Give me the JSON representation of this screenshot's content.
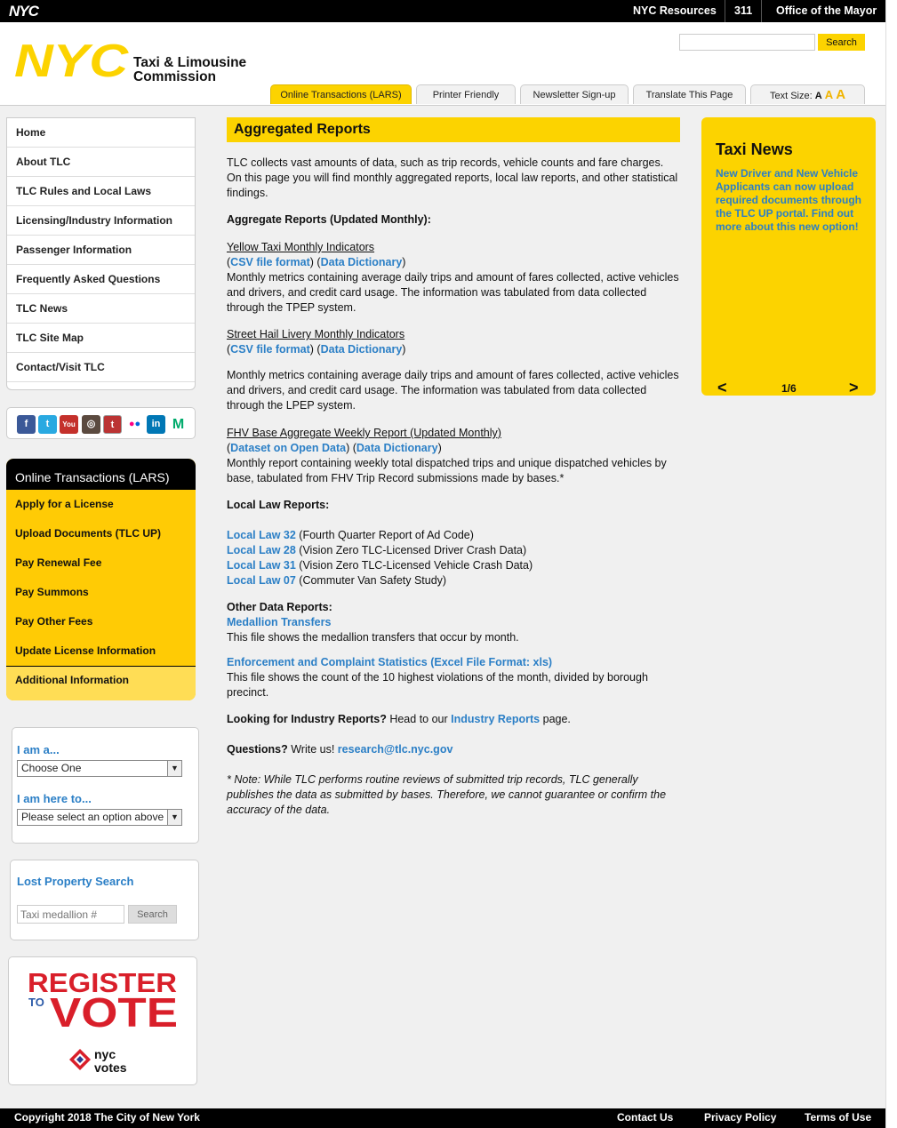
{
  "topbar": {
    "brand": "NYC",
    "links": [
      "NYC Resources",
      "311",
      "Office of the Mayor"
    ]
  },
  "header": {
    "logo_text": "NYC",
    "title_line1": "Taxi & Limousine",
    "title_line2": "Commission",
    "search_button": "Search",
    "search_value": "",
    "tabs": [
      "Online Transactions (LARS)",
      "Printer Friendly",
      "Newsletter Sign-up",
      "Translate This Page"
    ],
    "text_size_label": "Text Size:",
    "text_size_options": [
      "A",
      "A",
      "A"
    ]
  },
  "leftnav": {
    "items": [
      "Home",
      "About TLC",
      "TLC Rules and Local Laws",
      "Licensing/Industry Information",
      "Passenger Information",
      "Frequently Asked Questions",
      "TLC News",
      "TLC Site Map",
      "Contact/Visit TLC"
    ]
  },
  "social": {
    "icons": [
      "facebook-icon",
      "twitter-icon",
      "youtube-icon",
      "instagram-icon",
      "tumblr-icon",
      "flickr-icon",
      "linkedin-icon",
      "medium-icon"
    ]
  },
  "lars": {
    "title": "Online Transactions (LARS)",
    "items": [
      "Apply for a License",
      "Upload Documents (TLC UP)",
      "Pay Renewal Fee",
      "Pay Summons",
      "Pay Other Fees",
      "Update License Information",
      "Additional Information"
    ]
  },
  "iama": {
    "label1": "I am a...",
    "select1": "Choose One",
    "label2": "I am here to...",
    "select2": "Please select an option above"
  },
  "lost": {
    "title": "Lost Property Search",
    "placeholder": "Taxi medallion #",
    "button": "Search"
  },
  "vote": {
    "line1": "REGISTER",
    "to": "TO",
    "line2": "VOTE",
    "brand1": "nyc",
    "brand2": "votes"
  },
  "content": {
    "title": "Aggregated Reports",
    "intro": "TLC collects vast amounts of data, such as trip records, vehicle counts and fare charges. On this page you will find monthly aggregated reports, local law reports, and other statistical findings.",
    "agg_heading": "Aggregate Reports (Updated Monthly):",
    "r1_title": "Yellow Taxi Monthly Indicators",
    "r1_link1": "CSV file format",
    "r1_link2": "Data Dictionary",
    "r1_desc": "Monthly metrics containing average daily trips and amount of fares collected, active vehicles and drivers, and credit card usage. The information was tabulated from data collected through the TPEP system.",
    "r2_title": "Street Hail Livery Monthly Indicators",
    "r2_link1": "CSV file format",
    "r2_link2": "Data Dictionary",
    "r2_desc": "Monthly metrics containing average daily trips and amount of fares collected, active vehicles and drivers, and credit card usage. The information was tabulated from data collected through the LPEP system.",
    "r3_title": "FHV Base Aggregate Weekly Report (Updated Monthly)",
    "r3_link1": "Dataset on Open Data",
    "r3_link2": "Data Dictionary",
    "r3_desc": "Monthly report containing weekly total dispatched trips and unique dispatched vehicles by base, tabulated from FHV Trip Record submissions made by bases.*",
    "ll_heading": "Local Law Reports:",
    "local_laws": [
      {
        "link": "Local Law 32",
        "desc": " (Fourth Quarter Report of Ad Code)"
      },
      {
        "link": "Local Law 28",
        "desc": " (Vision Zero TLC-Licensed Driver Crash Data)"
      },
      {
        "link": "Local Law 31",
        "desc": " (Vision Zero TLC-Licensed Vehicle Crash Data)"
      },
      {
        "link": "Local Law 07",
        "desc": " (Commuter Van Safety Study)"
      }
    ],
    "other_heading": "Other Data Reports:",
    "med_link": "Medallion Transfers",
    "med_desc": "This file shows the medallion transfers that occur by month.",
    "enf_link": "Enforcement and Complaint Statistics (Excel File Format: xls)",
    "enf_desc": "This file shows the count of the 10 highest violations of the month, divided by borough precinct.",
    "ind_q": "Looking for Industry Reports?",
    "ind_pre": " Head to our ",
    "ind_link": "Industry Reports",
    "ind_post": " page.",
    "q_label": "Questions?",
    "q_pre": " Write us! ",
    "q_link": "research@tlc.nyc.gov",
    "note": "* Note: While TLC performs routine reviews of submitted trip records, TLC generally publishes the data as submitted by bases. Therefore, we cannot guarantee or confirm the accuracy of the data."
  },
  "taxinews": {
    "title": "Taxi News",
    "body": "New Driver and New Vehicle Applicants can now upload required documents through the TLC UP portal. Find out more about this new option!",
    "pager": "1/6",
    "prev": "<",
    "next": ">"
  },
  "footer": {
    "copyright": "Copyright 2018 The City of New York",
    "links": [
      "Contact Us",
      "Privacy Policy",
      "Terms of Use"
    ]
  },
  "colors": {
    "yellow": "#fcd300",
    "link_blue": "#2b7fc6",
    "black": "#000000",
    "panel_bg": "#f0f0f0"
  }
}
